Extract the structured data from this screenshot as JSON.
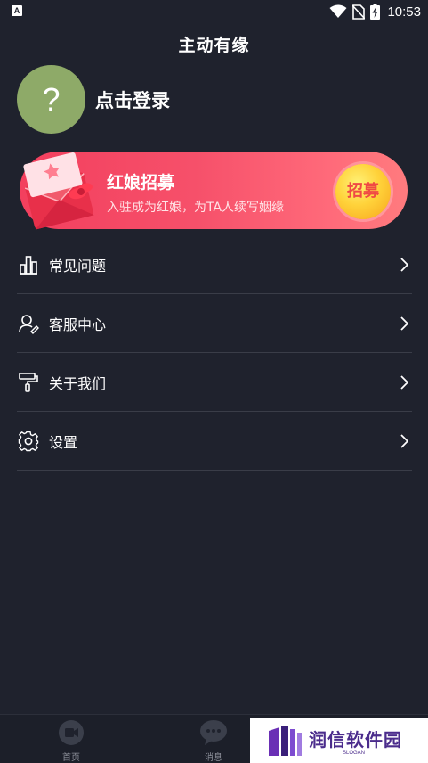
{
  "status_bar": {
    "app_icon_letter": "A",
    "time": "10:53"
  },
  "header": {
    "title": "主动有缘"
  },
  "profile": {
    "avatar_text": "?",
    "login_label": "点击登录"
  },
  "banner": {
    "title": "红娘招募",
    "subtitle": "入驻成为红娘，为TA人续写姻缘",
    "badge": "招募"
  },
  "menu": {
    "items": [
      {
        "label": "常见问题",
        "icon": "bar-chart-icon"
      },
      {
        "label": "客服中心",
        "icon": "user-service-icon"
      },
      {
        "label": "关于我们",
        "icon": "paint-roller-icon"
      },
      {
        "label": "设置",
        "icon": "gear-icon"
      }
    ]
  },
  "bottom_nav": {
    "items": [
      {
        "label": "首页",
        "icon": "video-icon"
      },
      {
        "label": "消息",
        "icon": "chat-icon"
      }
    ]
  },
  "watermark": {
    "text": "润信软件园",
    "slogan": "SLOGAN"
  },
  "colors": {
    "background": "#1f222d",
    "avatar": "#8eaa68",
    "banner_start": "#f33f5e",
    "banner_end": "#ff7b7e",
    "badge": "#ffd23a",
    "divider": "#3a3d48"
  }
}
